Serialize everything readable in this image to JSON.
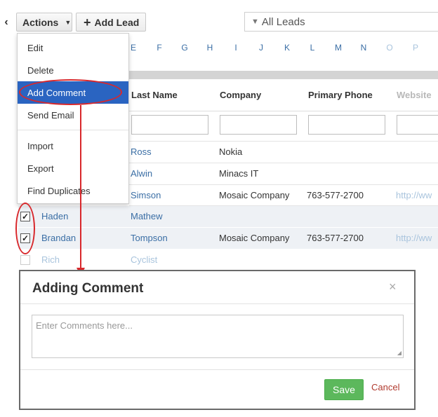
{
  "toolbar": {
    "back_icon": "chevron-left-icon",
    "actions_label": "Actions",
    "add_lead_label": "Add Lead",
    "filter_value": "All Leads"
  },
  "alphabet": [
    "E",
    "F",
    "G",
    "H",
    "I",
    "J",
    "K",
    "L",
    "M",
    "N",
    "O",
    "P"
  ],
  "menu": {
    "items": [
      {
        "label": "Edit"
      },
      {
        "label": "Delete"
      },
      {
        "label": "Add Comment"
      },
      {
        "label": "Send Email"
      },
      {
        "label": "Import"
      },
      {
        "label": "Export"
      },
      {
        "label": "Find Duplicates"
      }
    ]
  },
  "table": {
    "columns": [
      "Last Name",
      "Company",
      "Primary Phone",
      "Website"
    ],
    "rows": [
      {
        "first": "",
        "last": "Ross",
        "company": "Nokia",
        "phone": "",
        "website": ""
      },
      {
        "first": "",
        "last": "Alwin",
        "company": "Minacs IT",
        "phone": "",
        "website": ""
      },
      {
        "first": "",
        "last": "Simson",
        "company": "Mosaic Company",
        "phone": "763-577-2700",
        "website": "http://ww"
      },
      {
        "first": "Haden",
        "last": "Mathew",
        "company": "",
        "phone": "",
        "website": ""
      },
      {
        "first": "Brandan",
        "last": "Tompson",
        "company": "Mosaic Company",
        "phone": "763-577-2700",
        "website": "http://ww"
      },
      {
        "first": "Rich",
        "last": "Cyclist",
        "company": "",
        "phone": "",
        "website": ""
      }
    ]
  },
  "modal": {
    "title": "Adding Comment",
    "close_glyph": "×",
    "placeholder": "Enter Comments here...",
    "save_label": "Save",
    "cancel_label": "Cancel"
  },
  "colors": {
    "accent": "#2a64c1",
    "link": "#3a6ea5",
    "annotation": "#d8282c",
    "save": "#5cb85c",
    "cancel": "#b03a2e"
  }
}
